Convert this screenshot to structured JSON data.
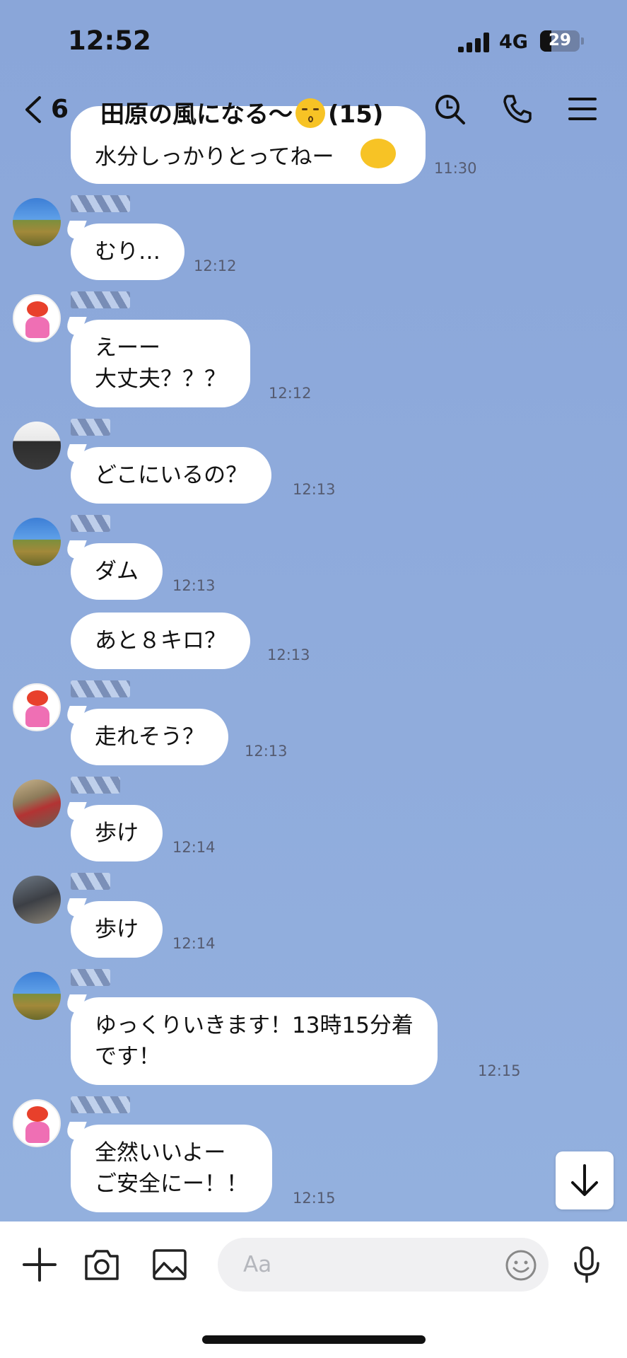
{
  "status_bar": {
    "time": "12:52",
    "network": "4G",
    "battery": "29",
    "battery_level": 0.29
  },
  "header": {
    "back_count": "6",
    "title": "田原の風になる〜",
    "member_count": "(15)"
  },
  "partial_top": {
    "text": "水分しっかりとってねー",
    "time": "11:30"
  },
  "messages": [
    {
      "text": "むり…",
      "time": "12:12"
    },
    {
      "text": "えーー\n大丈夫？？？",
      "time": "12:12"
    },
    {
      "text": "どこにいるの？",
      "time": "12:13"
    },
    {
      "text": "ダム",
      "time": "12:13"
    },
    {
      "text": "あと８キロ？",
      "time": "12:13"
    },
    {
      "text": "走れそう？",
      "time": "12:13"
    },
    {
      "text": "歩け",
      "time": "12:14"
    },
    {
      "text": "歩け",
      "time": "12:14"
    },
    {
      "text": "ゆっくりいきます！13時15分着\nです！",
      "time": "12:15"
    },
    {
      "text": "全然いいよー\nご安全にー！！",
      "time": "12:15"
    }
  ],
  "input": {
    "placeholder": "Aa"
  },
  "icons": {
    "back": "chevron-left-icon",
    "search": "search-icon",
    "call": "phone-icon",
    "menu": "menu-icon",
    "add": "plus-icon",
    "camera": "camera-icon",
    "image": "image-icon",
    "emoji": "smile-icon",
    "voice": "microphone-icon",
    "scroll": "arrow-down-icon"
  }
}
